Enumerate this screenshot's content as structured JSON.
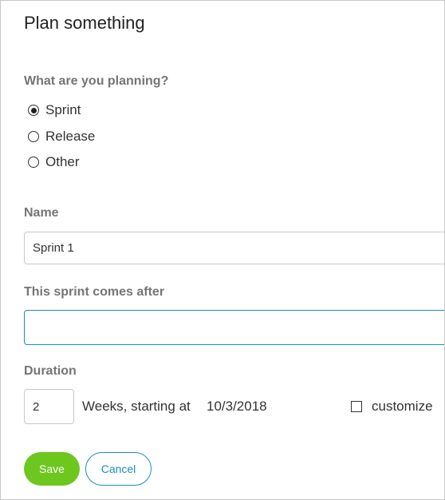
{
  "dialog": {
    "title": "Plan something"
  },
  "planning": {
    "label": "What are you planning?",
    "options": [
      {
        "label": "Sprint",
        "selected": true
      },
      {
        "label": "Release",
        "selected": false
      },
      {
        "label": "Other",
        "selected": false
      }
    ]
  },
  "name": {
    "label": "Name",
    "value": "Sprint 1"
  },
  "comes_after": {
    "label": "This sprint comes after",
    "value": ""
  },
  "duration": {
    "label": "Duration",
    "value": "2",
    "unit_text": "Weeks, starting at",
    "start_date": "10/3/2018",
    "customize_label": "customize",
    "customize_checked": false
  },
  "actions": {
    "save_label": "Save",
    "cancel_label": "Cancel"
  },
  "colors": {
    "save_button": "#6ec71f",
    "accent": "#1a8fb8",
    "label_gray": "#757575"
  }
}
